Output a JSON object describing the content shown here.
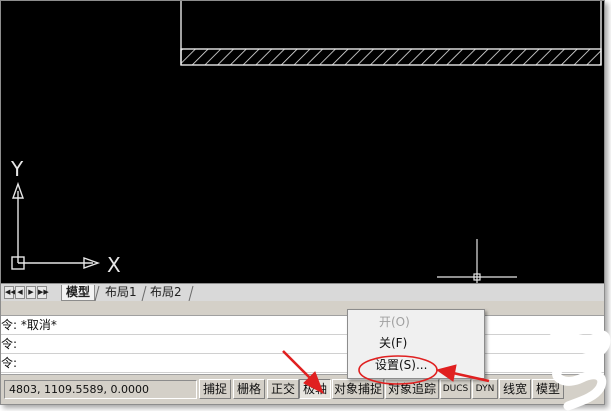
{
  "canvas": {
    "ucs_x_label": "X",
    "ucs_y_label": "Y"
  },
  "layout_tabs": {
    "nav_buttons": [
      "◀◀",
      "◀",
      "▶",
      "▶▶"
    ],
    "tabs": [
      {
        "label": "模型",
        "active": true
      },
      {
        "label": "布局1",
        "active": false
      },
      {
        "label": "布局2",
        "active": false
      }
    ]
  },
  "command": {
    "lines": [
      "令: *取消*",
      "令:",
      "令:"
    ]
  },
  "status_bar": {
    "coordinates": "4803, 1109.5589, 0.0000",
    "buttons": [
      {
        "label": "捕捉",
        "pressed": false
      },
      {
        "label": "栅格",
        "pressed": false
      },
      {
        "label": "正交",
        "pressed": false
      },
      {
        "label": "极轴",
        "pressed": true
      },
      {
        "label": "对象捕捉",
        "pressed": false
      },
      {
        "label": "对象追踪",
        "pressed": false
      },
      {
        "label": "DUCS",
        "pressed": false
      },
      {
        "label": "DYN",
        "pressed": false
      },
      {
        "label": "线宽",
        "pressed": false
      },
      {
        "label": "模型",
        "pressed": false
      }
    ]
  },
  "context_menu": {
    "items": [
      {
        "label": "开(O)",
        "disabled": true
      },
      {
        "label": "关(F)",
        "disabled": false
      },
      {
        "label": "设置(S)...",
        "disabled": false
      }
    ]
  },
  "colors": {
    "annotation_red": "#e02020"
  }
}
